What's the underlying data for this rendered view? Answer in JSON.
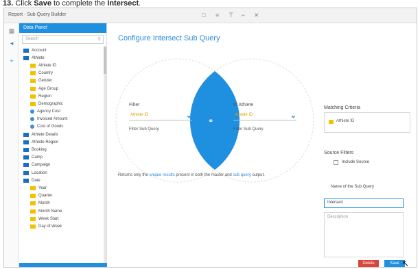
{
  "caption": {
    "step": "13.",
    "pre": "Click ",
    "button_word": "Save",
    "mid": " to complete the ",
    "target_word": "Intersect",
    "end": "."
  },
  "topbar": {
    "crumb": "Report · Sub Query Builder",
    "tools": [
      "□",
      "≡",
      "T",
      "⌐",
      "✕"
    ]
  },
  "sidebar": {
    "header": "Data Panel",
    "search_placeholder": "Search",
    "items": [
      {
        "label": "Account",
        "color": "blue",
        "indent": 0
      },
      {
        "label": "Athlete",
        "color": "blue",
        "indent": 0
      },
      {
        "label": "Athlete ID",
        "color": "yellow",
        "indent": 1
      },
      {
        "label": "Country",
        "color": "yellow",
        "indent": 1
      },
      {
        "label": "Gender",
        "color": "yellow",
        "indent": 1
      },
      {
        "label": "Age Group",
        "color": "yellow",
        "indent": 1
      },
      {
        "label": "Region",
        "color": "yellow",
        "indent": 1
      },
      {
        "label": "Demographic",
        "color": "yellow",
        "indent": 1
      },
      {
        "label": "Agency Cost",
        "color": "bluelight",
        "indent": 1
      },
      {
        "label": "Invoiced Amount",
        "color": "bluelight",
        "indent": 1
      },
      {
        "label": "Cost of Goods",
        "color": "bluelight",
        "indent": 1
      },
      {
        "label": "Athlete Details",
        "color": "blue",
        "indent": 0
      },
      {
        "label": "Athlete Region",
        "color": "blue",
        "indent": 0
      },
      {
        "label": "Booking",
        "color": "blue",
        "indent": 0
      },
      {
        "label": "Camp",
        "color": "blue",
        "indent": 0
      },
      {
        "label": "Campaign",
        "color": "blue",
        "indent": 0
      },
      {
        "label": "Location",
        "color": "blue",
        "indent": 0
      },
      {
        "label": "Date",
        "color": "blue",
        "indent": 0
      },
      {
        "label": "Year",
        "color": "yellow",
        "indent": 1
      },
      {
        "label": "Quarter",
        "color": "yellow",
        "indent": 1
      },
      {
        "label": "Month",
        "color": "yellow",
        "indent": 1
      },
      {
        "label": "Month Name",
        "color": "yellow",
        "indent": 1
      },
      {
        "label": "Week Start",
        "color": "yellow",
        "indent": 1
      },
      {
        "label": "Day of Week",
        "color": "yellow",
        "indent": 1
      }
    ]
  },
  "main": {
    "title": "Configure Intersect Sub Query",
    "left_label": "Filter",
    "left_value": "Athlete ID",
    "left_sub": "Filter Sub Query",
    "right_label": "In Athlete",
    "right_value": "Athlete ID",
    "right_sub": "Filter Sub Query",
    "description_a": "Returns only the ",
    "description_link1": "unique results",
    "description_b": " present in both the master and ",
    "description_link2": "sub query",
    "description_c": " output."
  },
  "right": {
    "matching_label": "Matching Criteria",
    "matching_chip": "Athlete ID",
    "source_label": "Source Filters",
    "source_checkbox": "Include Source",
    "name_label": "Name of the Sub Query",
    "name_value": "Intersect",
    "desc_placeholder": "Description",
    "delete_label": "Delete",
    "save_label": "Save"
  },
  "colors": {
    "accent": "#1f8fe0",
    "folder_yellow": "#f2c200",
    "delete_red": "#d8453a"
  }
}
